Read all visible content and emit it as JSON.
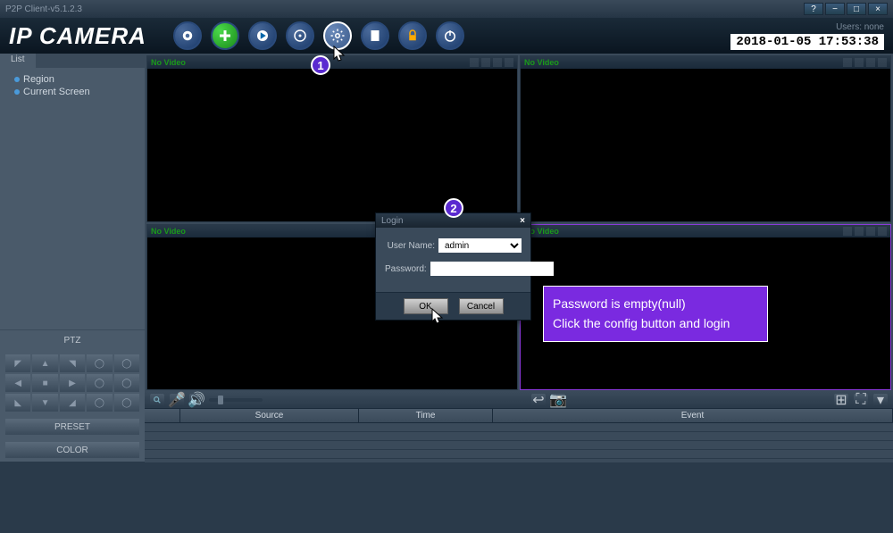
{
  "app": {
    "title": "P2P Client-v5.1.2.3",
    "logo": "IP CAMERA"
  },
  "header": {
    "users_label": "Users: none",
    "datetime": "2018-01-05  17:53:38"
  },
  "toolbar_icons": [
    "camera-icon",
    "add-icon",
    "play-icon",
    "target-icon",
    "config-icon",
    "file-icon",
    "lock-icon",
    "power-icon"
  ],
  "sidebar": {
    "tab": "List",
    "items": [
      {
        "label": "Region"
      },
      {
        "label": "Current Screen"
      }
    ],
    "ptz_label": "PTZ",
    "preset": "PRESET",
    "color": "COLOR"
  },
  "video": {
    "no_video": "No Video"
  },
  "log": {
    "cols": [
      "",
      "Source",
      "Time",
      "Event"
    ]
  },
  "dialog": {
    "title": "Login",
    "username_label": "User Name:",
    "username_value": "admin",
    "password_label": "Password:",
    "password_value": "",
    "ok": "OK",
    "cancel": "Cancel"
  },
  "callout": {
    "line1": "Password is empty(null)",
    "line2": "Click the config button and login"
  },
  "badges": {
    "b1": "1",
    "b2": "2"
  }
}
